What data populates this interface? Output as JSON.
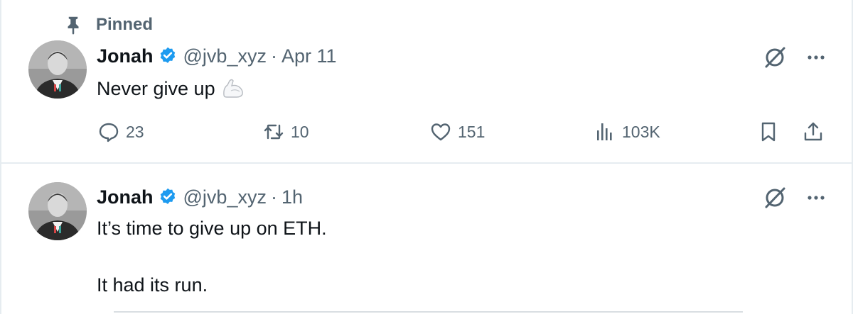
{
  "colors": {
    "text": "#0f1419",
    "secondary": "#536471",
    "verified": "#1d9bf0",
    "border": "#e6ecf0"
  },
  "pinned": {
    "label": "Pinned",
    "icon": "pin-icon"
  },
  "tweets": [
    {
      "name": "Jonah",
      "handle": "@jvb_xyz",
      "separator": "·",
      "timestamp": "Apr 11",
      "text": "Never give up",
      "emoji": "flexed-biceps",
      "actions": {
        "replies": "23",
        "retweets": "10",
        "likes": "151",
        "views": "103K"
      }
    },
    {
      "name": "Jonah",
      "handle": "@jvb_xyz",
      "separator": "·",
      "timestamp": "1h",
      "text_line1": "It’s time to give up on ETH.",
      "text_line2": "It had its run."
    }
  ]
}
